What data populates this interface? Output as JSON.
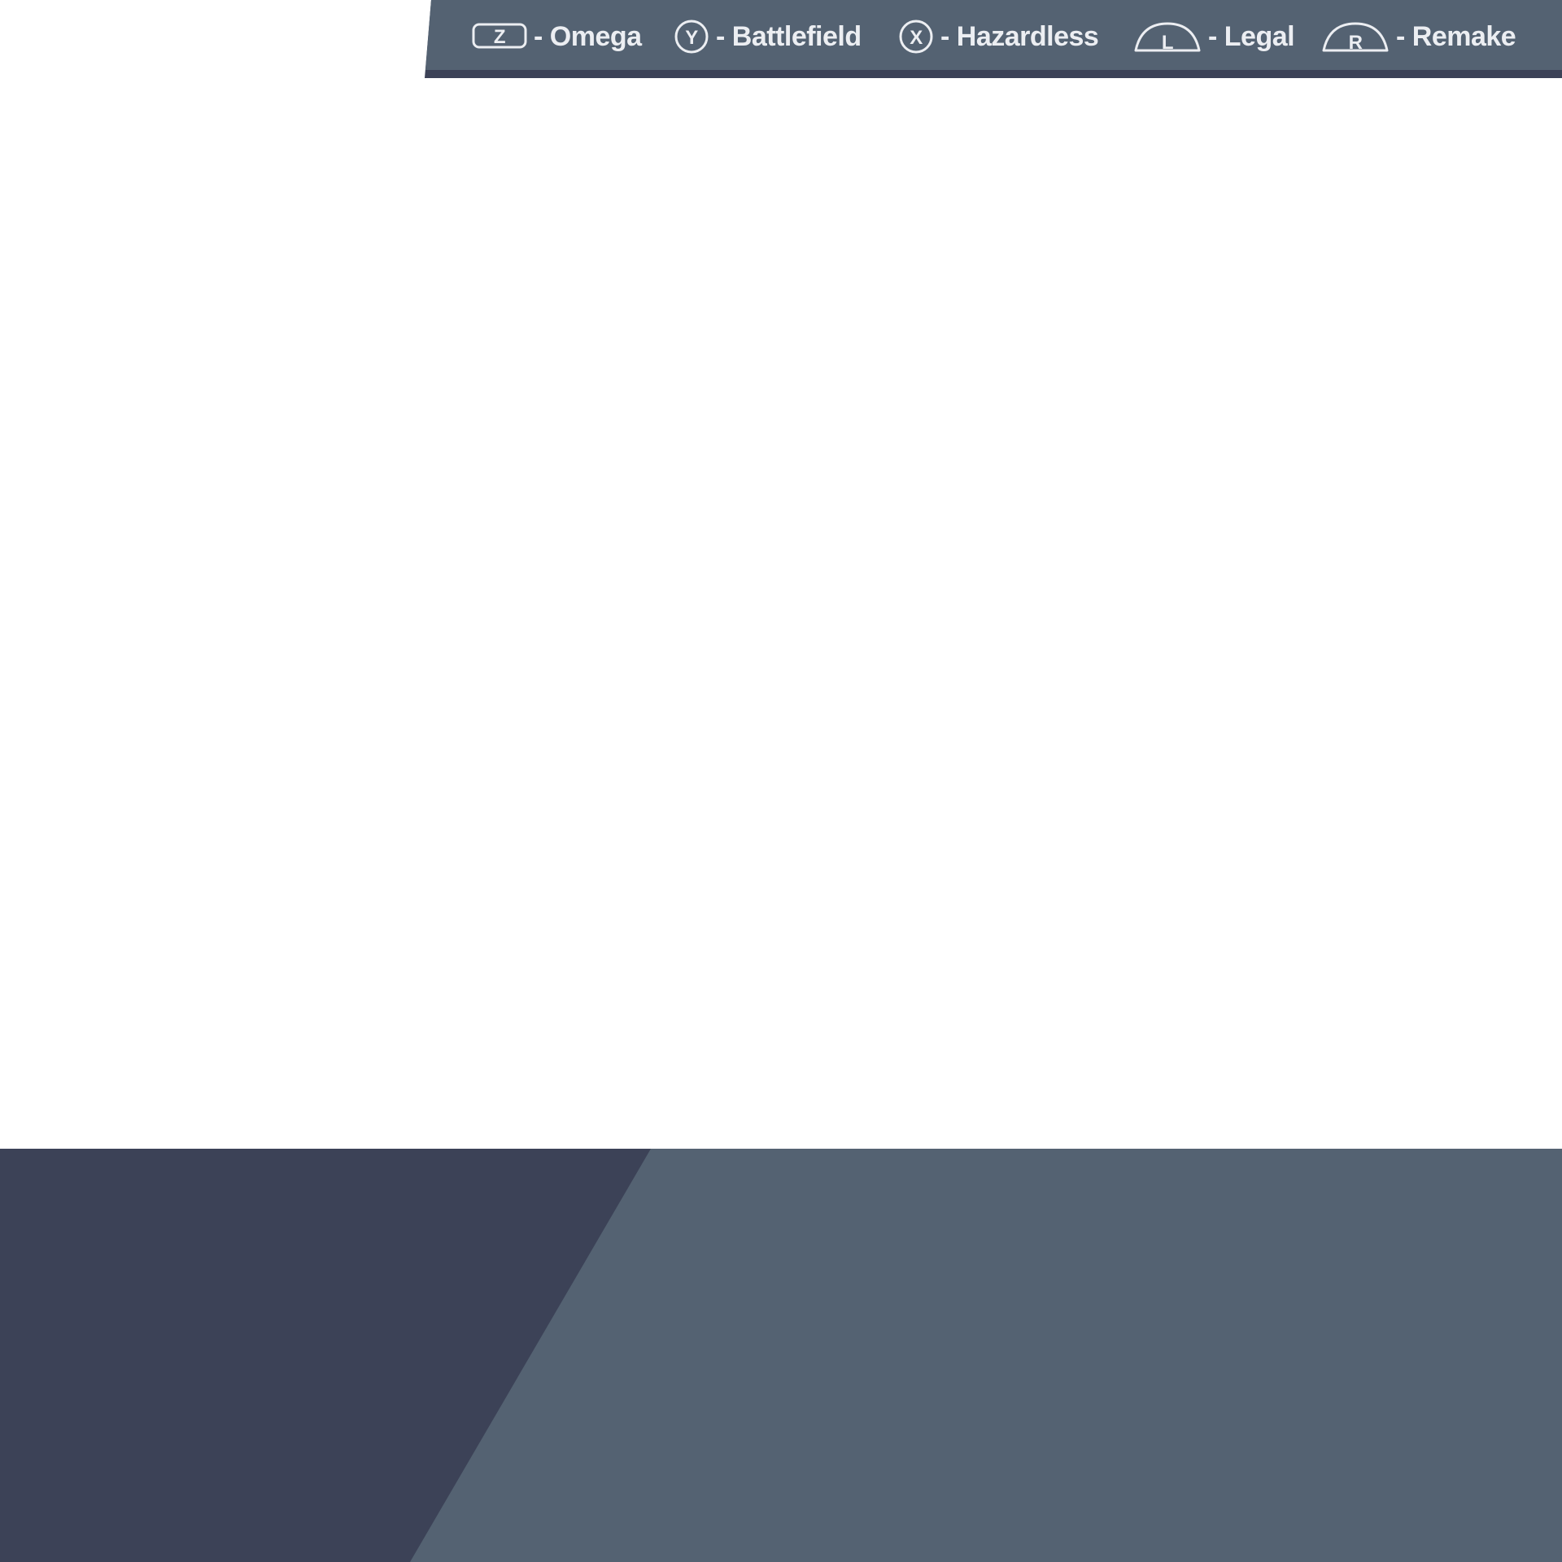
{
  "colors": {
    "bar_fill": "#546272",
    "bar_shadow": "#3c4257",
    "panel_dark": "#3c4257",
    "panel_light": "#546272",
    "text": "#eceef2"
  },
  "hints": [
    {
      "button": "Z",
      "icon": "z-button-icon",
      "label": "- Omega"
    },
    {
      "button": "Y",
      "icon": "y-button-icon",
      "label": "- Battlefield"
    },
    {
      "button": "X",
      "icon": "x-button-icon",
      "label": "- Hazardless"
    },
    {
      "button": "L",
      "icon": "l-trigger-icon",
      "label": "- Legal"
    },
    {
      "button": "R",
      "icon": "r-trigger-icon",
      "label": "- Remake"
    }
  ]
}
